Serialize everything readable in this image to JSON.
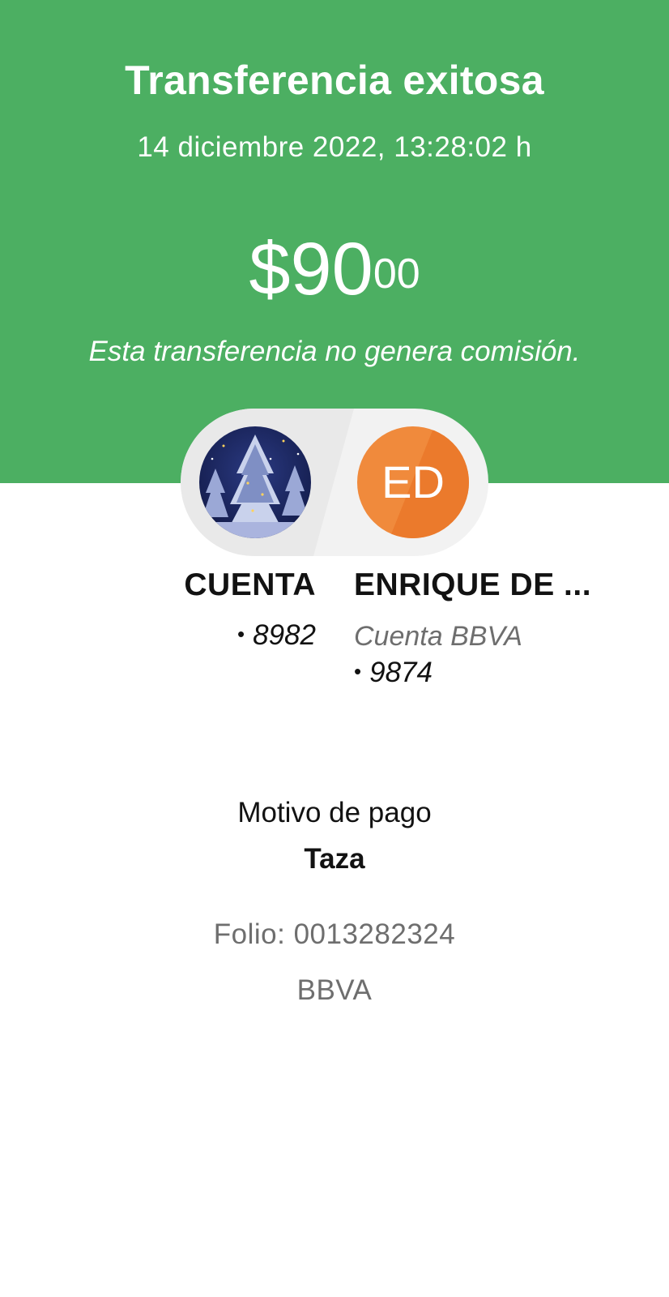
{
  "header": {
    "title": "Transferencia exitosa",
    "datetime": "14 diciembre 2022, 13:28:02 h",
    "amount": {
      "whole": "$90",
      "cents": "00"
    },
    "commission_note": "Esta transferencia no genera comisión.",
    "background_color": "#4caf62"
  },
  "sender": {
    "avatar": "winter-night-trees-photo",
    "name": "CUENTA",
    "bullet": "•",
    "account": "8982"
  },
  "recipient": {
    "initials": "ED",
    "avatar_color": "#f08a3c",
    "name": "ENRIQUE DE ...",
    "bank_account_type": "Cuenta BBVA",
    "bullet": "•",
    "account": "9874"
  },
  "details": {
    "motivo_label": "Motivo de pago",
    "motivo_value": "Taza",
    "folio": "Folio: 0013282324",
    "bank": "BBVA"
  }
}
